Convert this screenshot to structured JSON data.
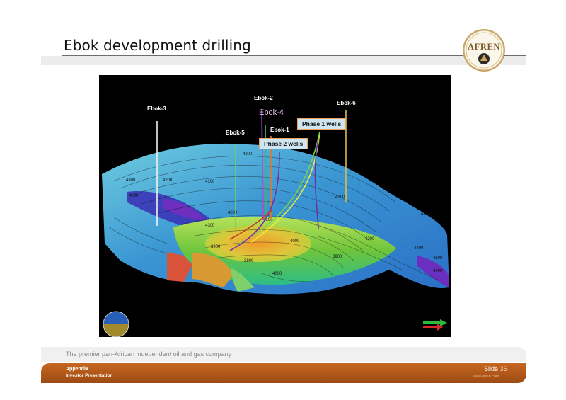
{
  "slide": {
    "title": "Ebok development drilling",
    "logo_text": "AFREN",
    "tagline": "The premier pan-African independent oil and gas company",
    "footer_line1": "Appendix",
    "footer_line2": "Investor Presentation",
    "slide_label": "Slide",
    "slide_number": "36",
    "website": "www.afren.com"
  },
  "figure": {
    "wells": [
      "Ebok-3",
      "Ebok-2",
      "Ebok-4",
      "Ebok-6",
      "Ebok-5",
      "Ebok-1"
    ],
    "callouts": [
      "Phase 1 wells",
      "Phase 2 wells"
    ],
    "contour_labels": [
      "4200",
      "4200",
      "4300",
      "4100",
      "4300",
      "4000",
      "4300",
      "4100",
      "4000",
      "3800",
      "3900",
      "3900",
      "4000",
      "4200",
      "4300",
      "4400",
      "4500",
      "4600",
      "4300"
    ]
  },
  "colors": {
    "accent_orange": "#b85a1a",
    "callout_fill": "#cfe6f1",
    "callout_border": "#f0a35e"
  }
}
